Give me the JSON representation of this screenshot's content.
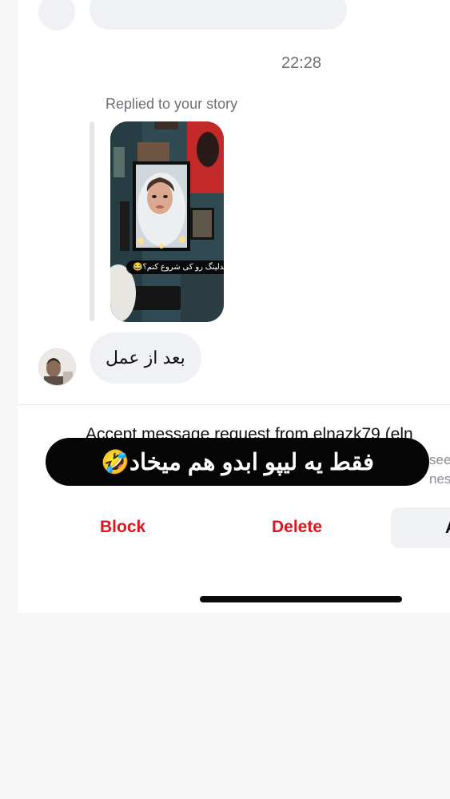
{
  "thread": {
    "timestamp": "22:28",
    "replied_label": "Replied to your story",
    "story_caption": "مدلینگ رو کی شروع کنم؟😂",
    "message_text": "بعد از عمل"
  },
  "request": {
    "title": "Accept message request from elnazk79 (eln",
    "desc_line1": "see",
    "desc_line2": "ness"
  },
  "actions": {
    "block_label": "Block",
    "delete_label": "Delete",
    "accept_label": "A"
  },
  "overlay": {
    "caption": "فقط یه لیپو ابدو هم میخاد🤣"
  },
  "colors": {
    "destructive": "#e0151d",
    "bubble": "#eff1f4",
    "muted_text": "#6b6f76"
  }
}
